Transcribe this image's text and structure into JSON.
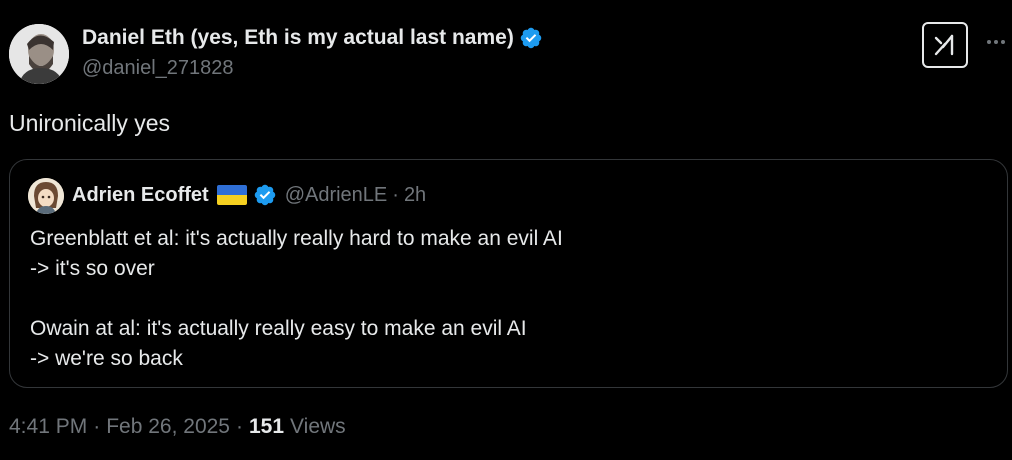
{
  "author": {
    "display_name": "Daniel Eth (yes, Eth is my actual last name)",
    "handle": "@daniel_271828",
    "avatar_icon": "avatar-photo",
    "verified": true
  },
  "actions": {
    "grok_icon": "grok-icon",
    "more_icon": "more-icon"
  },
  "tweet": {
    "text": "Unironically yes"
  },
  "quote": {
    "display_name": "Adrien Ecoffet",
    "flag_icon": "ukraine-flag-icon",
    "verified": true,
    "handle": "@AdrienLE",
    "separator": "·",
    "time": "2h",
    "lines": [
      "Greenblatt et al: it's actually really hard to make an evil AI",
      "-> it's so over",
      "",
      "Owain at al: it's actually really easy to make an evil AI",
      "-> we're so back"
    ]
  },
  "meta": {
    "time": "4:41 PM",
    "separator1": "·",
    "date": "Feb 26, 2025",
    "separator2": "·",
    "views_count": "151",
    "views_label": "Views"
  },
  "colors": {
    "background": "#000000",
    "primary_text": "#e7e9ea",
    "secondary_text": "#71767b",
    "verified_blue": "#1d9bf0",
    "border": "#333639"
  }
}
